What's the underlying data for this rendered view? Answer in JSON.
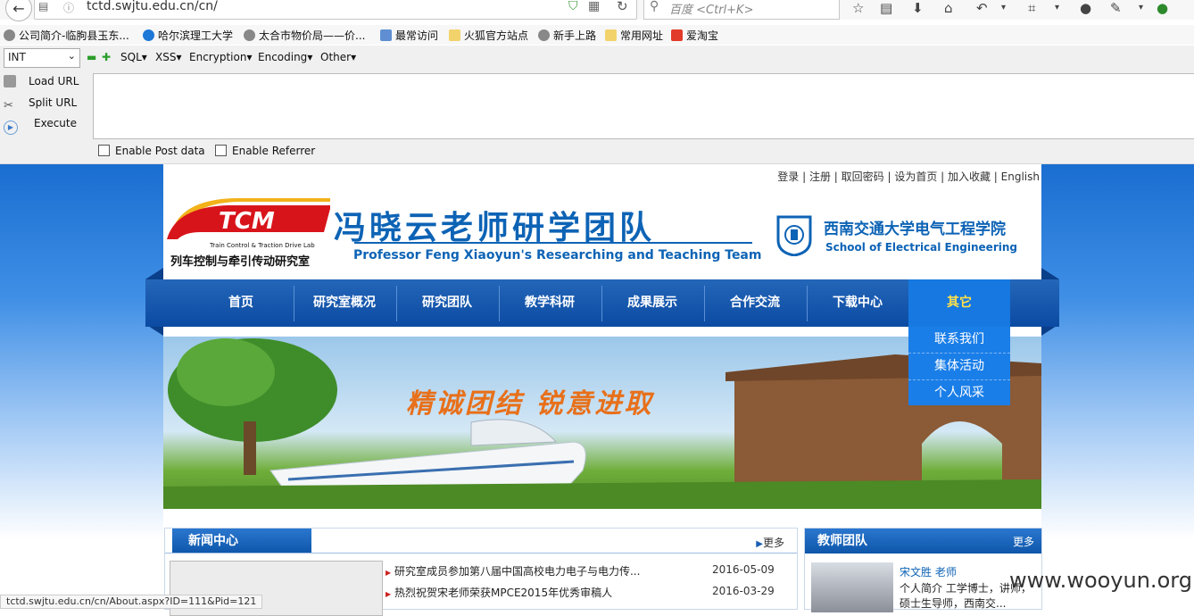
{
  "browser": {
    "url": "tctd.swjtu.edu.cn/cn/",
    "search_placeholder": "百度 <Ctrl+K>"
  },
  "bookmarks": [
    {
      "label": "公司简介-临朐县玉东...",
      "icon": "globe-icon"
    },
    {
      "label": "哈尔滨理工大学",
      "icon": "globe-icon"
    },
    {
      "label": "太合市物价局——价...",
      "icon": "globe-icon"
    },
    {
      "label": "最常访问",
      "icon": "folder-icon"
    },
    {
      "label": "火狐官方站点",
      "icon": "folder-icon"
    },
    {
      "label": "新手上路",
      "icon": "globe-icon"
    },
    {
      "label": "常用网址",
      "icon": "folder-icon"
    },
    {
      "label": "爱淘宝",
      "icon": "taobao-icon"
    }
  ],
  "hackbar": {
    "select_value": "INT",
    "menus": [
      "SQL",
      "XSS",
      "Encryption",
      "Encoding",
      "Other"
    ],
    "load_url": "Load URL",
    "split_url": "Split URL",
    "execute": "Execute",
    "enable_post": "Enable Post data",
    "enable_referrer": "Enable Referrer"
  },
  "site": {
    "top_links": "登录 | 注册 | 取回密码 | 设为首页 | 加入收藏 | English",
    "logo_text": "TCM",
    "lab_en": "Train Control & Traction Drive Lab",
    "lab_cn": "列车控制与牵引传动研究室",
    "team_title": "冯晓云老师研学团队",
    "team_subtitle": "Professor Feng Xiaoyun's Researching and Teaching Team",
    "school_cn": "西南交通大学电气工程学院",
    "school_en": "School of Electrical Engineering",
    "nav": [
      "首页",
      "研究室概况",
      "研究团队",
      "教学科研",
      "成果展示",
      "合作交流",
      "下载中心",
      "其它"
    ],
    "dropdown": [
      "联系我们",
      "集体活动",
      "个人风采"
    ],
    "hero_slogan": "精诚团结 锐意进取",
    "news": {
      "title": "新闻中心",
      "more": "更多",
      "items": [
        {
          "title": "研究室成员参加第八届中国高校电力电子与电力传...",
          "date": "2016-05-09"
        },
        {
          "title": "热烈祝贺宋老师荣获MPCE2015年优秀审稿人",
          "date": "2016-03-29"
        }
      ]
    },
    "teachers": {
      "title": "教师团队",
      "more": "更多",
      "name": "宋文胜 老师",
      "desc": "个人简介 工学博士，讲师，硕士生导师，西南交..."
    }
  },
  "status_url": "tctd.swjtu.edu.cn/cn/About.aspx?ID=111&Pid=121",
  "watermark": "www.wooyun.org",
  "colors": {
    "brand_blue": "#0d63b5",
    "nav_active_text": "#ffe14a",
    "slogan": "#e8701a"
  }
}
